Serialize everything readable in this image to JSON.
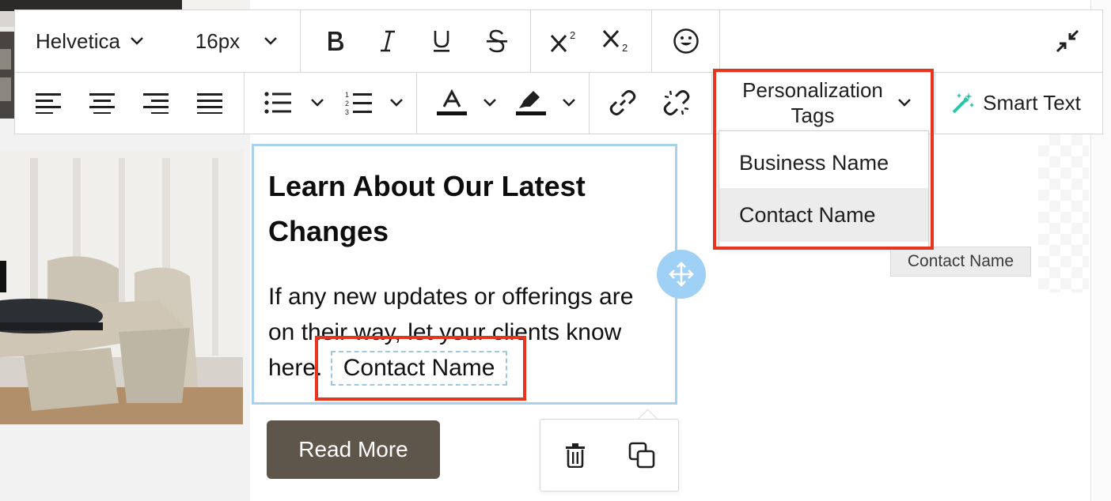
{
  "toolbar": {
    "font_family": "Helvetica",
    "font_size": "16px",
    "personalization_label_line1": "Personalization",
    "personalization_label_line2": "Tags",
    "smart_text_label": "Smart Text",
    "text_color_accent": "#111111",
    "smart_text_icon_color": "#2cc4a6"
  },
  "personalization_menu": {
    "items": [
      {
        "label": "Business Name"
      },
      {
        "label": "Contact Name"
      }
    ],
    "hovered_item_tooltip": "Contact Name"
  },
  "content": {
    "heading": "Learn About Our Latest Changes",
    "body_prefix": "If any new updates or offerings are on their way, let your clients know here.",
    "inserted_tag": "Contact Name",
    "button_label": "Read More"
  },
  "colors": {
    "highlight": "#e8341c",
    "selection_border": "#a8d1ee",
    "button_bg": "#5f564b"
  }
}
